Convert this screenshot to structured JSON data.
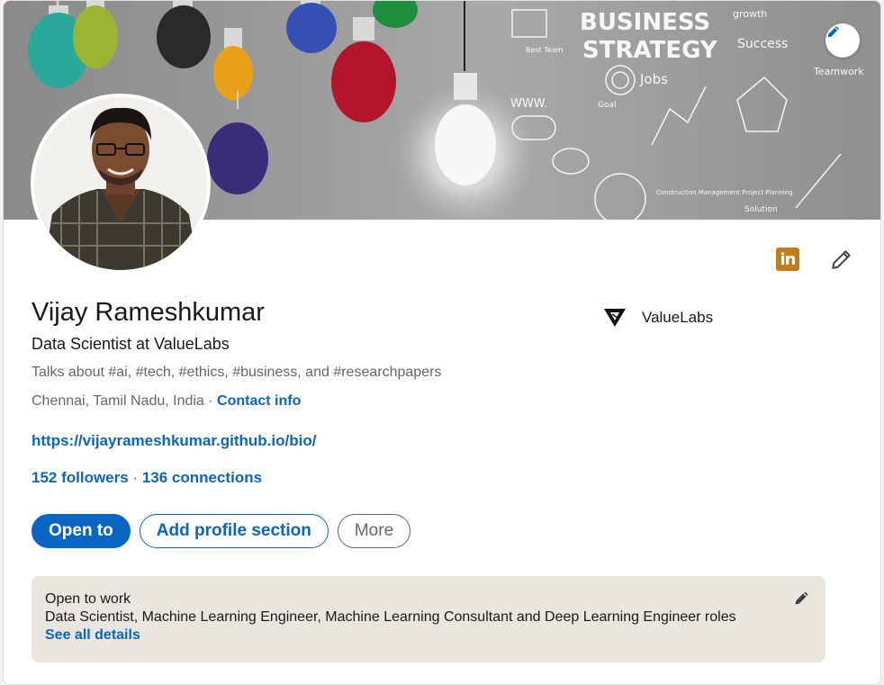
{
  "banner": {
    "image_text": [
      "BUSINESS",
      "STRATEGY",
      "Success",
      "Jobs",
      "Teamwork",
      "WWW.",
      "growth",
      "Goal",
      "Solution",
      "Best Team",
      "Construction Management Project Planning"
    ],
    "edit_icon": "pencil-icon"
  },
  "profile": {
    "name": "Vijay Rameshkumar",
    "headline": "Data Scientist at ValueLabs",
    "talks_about": "Talks about #ai, #tech, #ethics, #business, and #researchpapers",
    "location": "Chennai, Tamil Nadu, India",
    "location_sep": " · ",
    "contact_info": "Contact info",
    "website": "https://vijayrameshkumar.github.io/bio/",
    "followers": "152 followers",
    "stats_sep": " · ",
    "connections": "136 connections"
  },
  "company": {
    "name": "ValueLabs"
  },
  "top_icons": {
    "linkedin_label": "in",
    "edit": "pencil-icon"
  },
  "actions": {
    "open_to": "Open to",
    "add_section": "Add profile section",
    "more": "More"
  },
  "open_to_work": {
    "title": "Open to work",
    "roles": "Data Scientist, Machine Learning Engineer, Machine Learning Consultant and Deep Learning Engineer roles",
    "see_all": "See all details"
  },
  "colors": {
    "accent": "#0a66c2",
    "linkedin_badge": "#c37d16",
    "muted": "#666666",
    "panel": "#e8e6df"
  }
}
